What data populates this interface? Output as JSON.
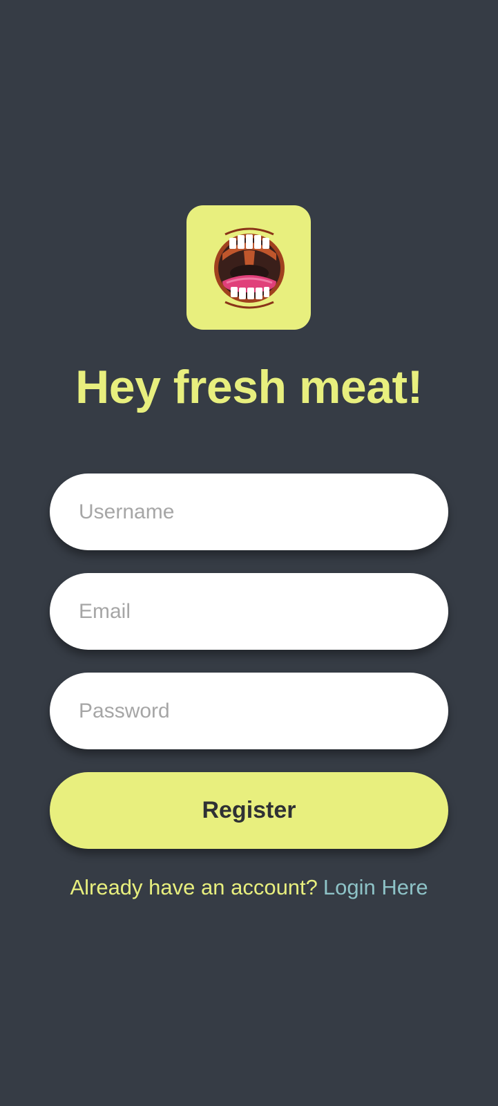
{
  "colors": {
    "background": "#363c45",
    "accent": "#e8ef7e",
    "link": "#8ec3c7",
    "field_background": "#ffffff",
    "placeholder": "#a6a6a6",
    "button_text": "#2f3134"
  },
  "logo": {
    "icon": "open-mouth-icon"
  },
  "header": {
    "title": "Hey fresh meat!"
  },
  "form": {
    "username": {
      "value": "",
      "placeholder": "Username"
    },
    "email": {
      "value": "",
      "placeholder": "Email"
    },
    "password": {
      "value": "",
      "placeholder": "Password"
    },
    "register_label": "Register"
  },
  "footer": {
    "prompt": "Already have an account?",
    "login_link": "Login Here"
  }
}
